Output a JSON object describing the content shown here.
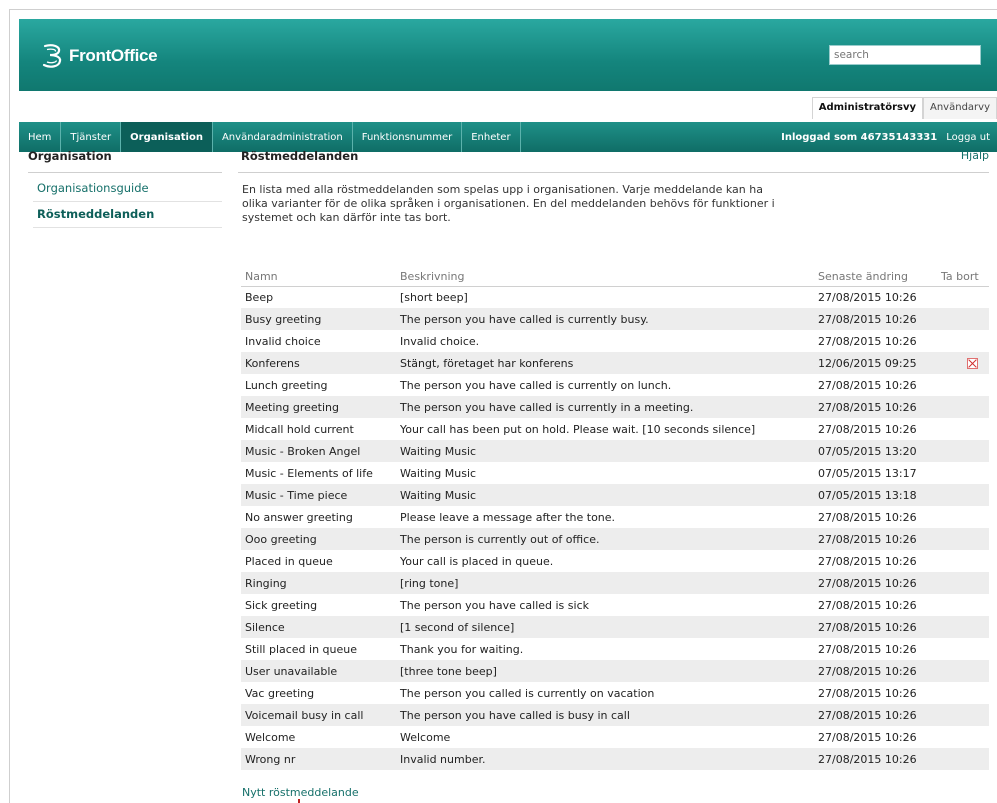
{
  "brand": {
    "name": "FrontOffice",
    "logo_icon": "three-logo-icon",
    "color": "#14857d"
  },
  "search": {
    "placeholder": "search"
  },
  "view_tabs": [
    {
      "label": "Administratörsvy",
      "active": true
    },
    {
      "label": "Användarvy",
      "active": false
    }
  ],
  "nav": {
    "items": [
      {
        "label": "Hem",
        "active": false
      },
      {
        "label": "Tjänster",
        "active": false
      },
      {
        "label": "Organisation",
        "active": true
      },
      {
        "label": "Användaradministration",
        "active": false
      },
      {
        "label": "Funktionsnummer",
        "active": false
      },
      {
        "label": "Enheter",
        "active": false
      }
    ],
    "logged_in": "Inloggad som 46735143331",
    "logout": "Logga ut"
  },
  "sidebar": {
    "title": "Organisation",
    "items": [
      {
        "label": "Organisationsguide",
        "active": false
      },
      {
        "label": "Röstmeddelanden",
        "active": true
      }
    ]
  },
  "main": {
    "title": "Röstmeddelanden",
    "help": "Hjälp",
    "intro": "En lista med alla röstmeddelanden som spelas upp i organisationen. Varje meddelande kan ha olika varianter för de olika språken i organisationen. En del meddelanden behövs för funktioner i systemet och kan därför inte tas bort.",
    "columns": {
      "name": "Namn",
      "desc": "Beskrivning",
      "date": "Senaste ändring",
      "delete": "Ta bort"
    },
    "rows": [
      {
        "name": "Beep",
        "desc": "[short beep]",
        "date": "27/08/2015 10:26",
        "deletable": false
      },
      {
        "name": "Busy greeting",
        "desc": "The person you have called is currently busy.",
        "date": "27/08/2015 10:26",
        "deletable": false
      },
      {
        "name": "Invalid choice",
        "desc": "Invalid choice.",
        "date": "27/08/2015 10:26",
        "deletable": false
      },
      {
        "name": "Konferens",
        "desc": "Stängt, företaget har konferens",
        "date": "12/06/2015 09:25",
        "deletable": true
      },
      {
        "name": "Lunch greeting",
        "desc": "The person you have called is currently on lunch.",
        "date": "27/08/2015 10:26",
        "deletable": false
      },
      {
        "name": "Meeting greeting",
        "desc": "The person you have called is currently in a meeting.",
        "date": "27/08/2015 10:26",
        "deletable": false
      },
      {
        "name": "Midcall hold current",
        "desc": "Your call has been put on hold. Please wait. [10 seconds silence]",
        "date": "27/08/2015 10:26",
        "deletable": false
      },
      {
        "name": "Music - Broken Angel",
        "desc": "Waiting Music",
        "date": "07/05/2015 13:20",
        "deletable": false
      },
      {
        "name": "Music - Elements of life",
        "desc": "Waiting Music",
        "date": "07/05/2015 13:17",
        "deletable": false
      },
      {
        "name": "Music - Time piece",
        "desc": "Waiting Music",
        "date": "07/05/2015 13:18",
        "deletable": false
      },
      {
        "name": "No answer greeting",
        "desc": "Please leave a message after the tone.",
        "date": "27/08/2015 10:26",
        "deletable": false
      },
      {
        "name": "Ooo greeting",
        "desc": "The person is currently out of office.",
        "date": "27/08/2015 10:26",
        "deletable": false
      },
      {
        "name": "Placed in queue",
        "desc": "Your call is placed in queue.",
        "date": "27/08/2015 10:26",
        "deletable": false
      },
      {
        "name": "Ringing",
        "desc": "[ring tone]",
        "date": "27/08/2015 10:26",
        "deletable": false
      },
      {
        "name": "Sick greeting",
        "desc": "The person you have called is sick",
        "date": "27/08/2015 10:26",
        "deletable": false
      },
      {
        "name": "Silence",
        "desc": "[1 second of silence]",
        "date": "27/08/2015 10:26",
        "deletable": false
      },
      {
        "name": "Still placed in queue",
        "desc": "Thank you for waiting.",
        "date": "27/08/2015 10:26",
        "deletable": false
      },
      {
        "name": "User unavailable",
        "desc": "[three tone beep]",
        "date": "27/08/2015 10:26",
        "deletable": false
      },
      {
        "name": "Vac greeting",
        "desc": "The person you called is currently on vacation",
        "date": "27/08/2015 10:26",
        "deletable": false
      },
      {
        "name": "Voicemail busy in call",
        "desc": "The person you have called is busy in call",
        "date": "27/08/2015 10:26",
        "deletable": false
      },
      {
        "name": "Welcome",
        "desc": "Welcome",
        "date": "27/08/2015 10:26",
        "deletable": false
      },
      {
        "name": "Wrong nr",
        "desc": "Invalid number.",
        "date": "27/08/2015 10:26",
        "deletable": false
      }
    ],
    "new_link": "Nytt röstmeddelande"
  }
}
